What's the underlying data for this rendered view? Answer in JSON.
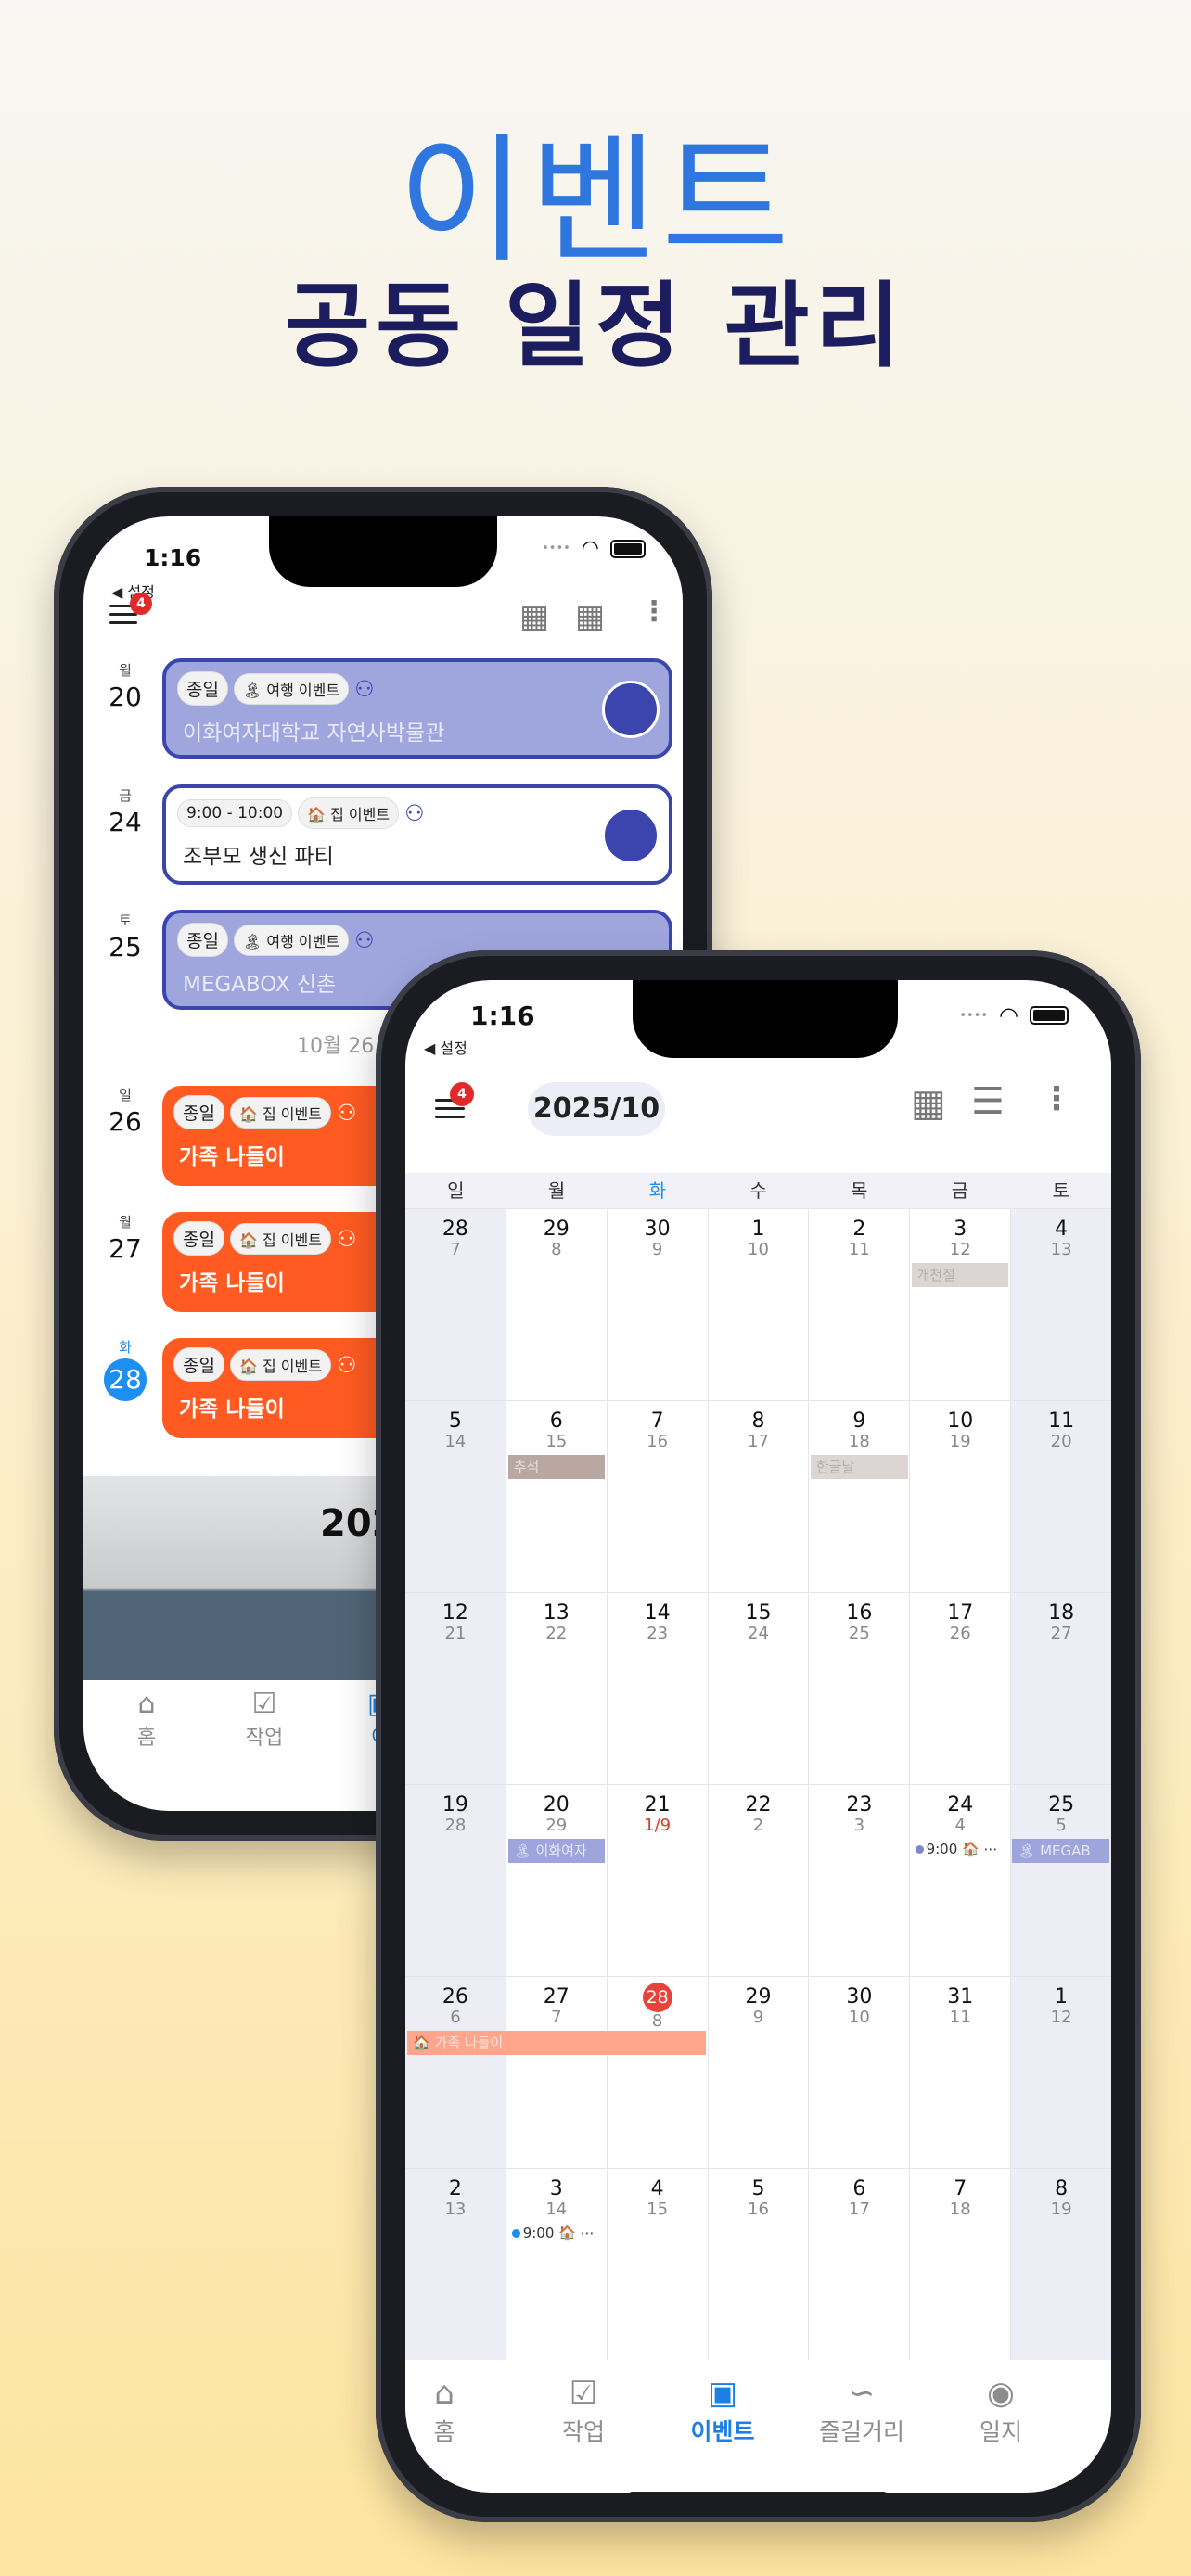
{
  "promo": {
    "headline": "이벤트",
    "subline": "공동 일정 관리"
  },
  "phone_list": {
    "status_time": "1:16",
    "back_label": "◀ 설정",
    "menu_badge": "4",
    "days": [
      {
        "dow": "월",
        "num": "20"
      },
      {
        "dow": "금",
        "num": "24"
      },
      {
        "dow": "토",
        "num": "25"
      },
      {
        "dow": "일",
        "num": "26"
      },
      {
        "dow": "월",
        "num": "27"
      },
      {
        "dow": "화",
        "num": "28"
      }
    ],
    "events": [
      {
        "time": "종일",
        "category": "여행 이벤트",
        "title": "이화여자대학교 자연사박물관"
      },
      {
        "time": "9:00 - 10:00",
        "category": "집 이벤트",
        "title": "조부모 생신 파티"
      },
      {
        "time": "종일",
        "category": "여행 이벤트",
        "title": "MEGABOX 신촌"
      },
      {
        "time": "종일",
        "category": "집 이벤트",
        "title": "가족 나들이"
      },
      {
        "time": "종일",
        "category": "집 이벤트",
        "title": "가족 나들이"
      },
      {
        "time": "종일",
        "category": "집 이벤트",
        "title": "가족 나들이"
      }
    ],
    "divider": "10월 26",
    "banner_year": "202",
    "tabs": [
      {
        "label": "홈",
        "icon": "home-icon"
      },
      {
        "label": "작업",
        "icon": "checklist-icon"
      },
      {
        "label": "이",
        "icon": "calendar-heart-icon"
      }
    ]
  },
  "phone_calendar": {
    "status_time": "1:16",
    "back_label": "◀ 설정",
    "menu_badge": "4",
    "month": "2025/10",
    "weekdays": [
      "일",
      "월",
      "화",
      "수",
      "목",
      "금",
      "토"
    ],
    "weeks": [
      [
        [
          "28",
          "7"
        ],
        [
          "29",
          "8"
        ],
        [
          "30",
          "9"
        ],
        [
          "1",
          "10"
        ],
        [
          "2",
          "11"
        ],
        [
          "3",
          "12"
        ],
        [
          "4",
          "13"
        ]
      ],
      [
        [
          "5",
          "14"
        ],
        [
          "6",
          "15"
        ],
        [
          "7",
          "16"
        ],
        [
          "8",
          "17"
        ],
        [
          "9",
          "18"
        ],
        [
          "10",
          "19"
        ],
        [
          "11",
          "20"
        ]
      ],
      [
        [
          "12",
          "21"
        ],
        [
          "13",
          "22"
        ],
        [
          "14",
          "23"
        ],
        [
          "15",
          "24"
        ],
        [
          "16",
          "25"
        ],
        [
          "17",
          "26"
        ],
        [
          "18",
          "27"
        ]
      ],
      [
        [
          "19",
          "28"
        ],
        [
          "20",
          "29"
        ],
        [
          "21",
          "1/9"
        ],
        [
          "22",
          "2"
        ],
        [
          "23",
          "3"
        ],
        [
          "24",
          "4"
        ],
        [
          "25",
          "5"
        ]
      ],
      [
        [
          "26",
          "6"
        ],
        [
          "27",
          "7"
        ],
        [
          "28",
          "8"
        ],
        [
          "29",
          "9"
        ],
        [
          "30",
          "10"
        ],
        [
          "31",
          "11"
        ],
        [
          "1",
          "12"
        ]
      ],
      [
        [
          "2",
          "13"
        ],
        [
          "3",
          "14"
        ],
        [
          "4",
          "15"
        ],
        [
          "5",
          "16"
        ],
        [
          "6",
          "17"
        ],
        [
          "7",
          "18"
        ],
        [
          "8",
          "19"
        ]
      ]
    ],
    "calendar_events": {
      "w1_fri": "개천절",
      "w2_mon": "추석",
      "w2_thu": "한글날",
      "w4_mon": "이화여자",
      "w4_fri": "9:00",
      "w4_sat": "MEGAB",
      "w5_sun": "가족 나들이",
      "w6_mon": "9:00"
    },
    "tabs": [
      {
        "label": "홈",
        "icon": "home-icon"
      },
      {
        "label": "작업",
        "icon": "checklist-icon"
      },
      {
        "label": "이벤트",
        "icon": "calendar-heart-icon"
      },
      {
        "label": "즐길거리",
        "icon": "route-icon"
      },
      {
        "label": "일지",
        "icon": "signal-icon"
      }
    ],
    "colors": {
      "accent": "#1d7fe6",
      "today": "#e8423a",
      "holiday_lunar": "#e0362f"
    }
  }
}
